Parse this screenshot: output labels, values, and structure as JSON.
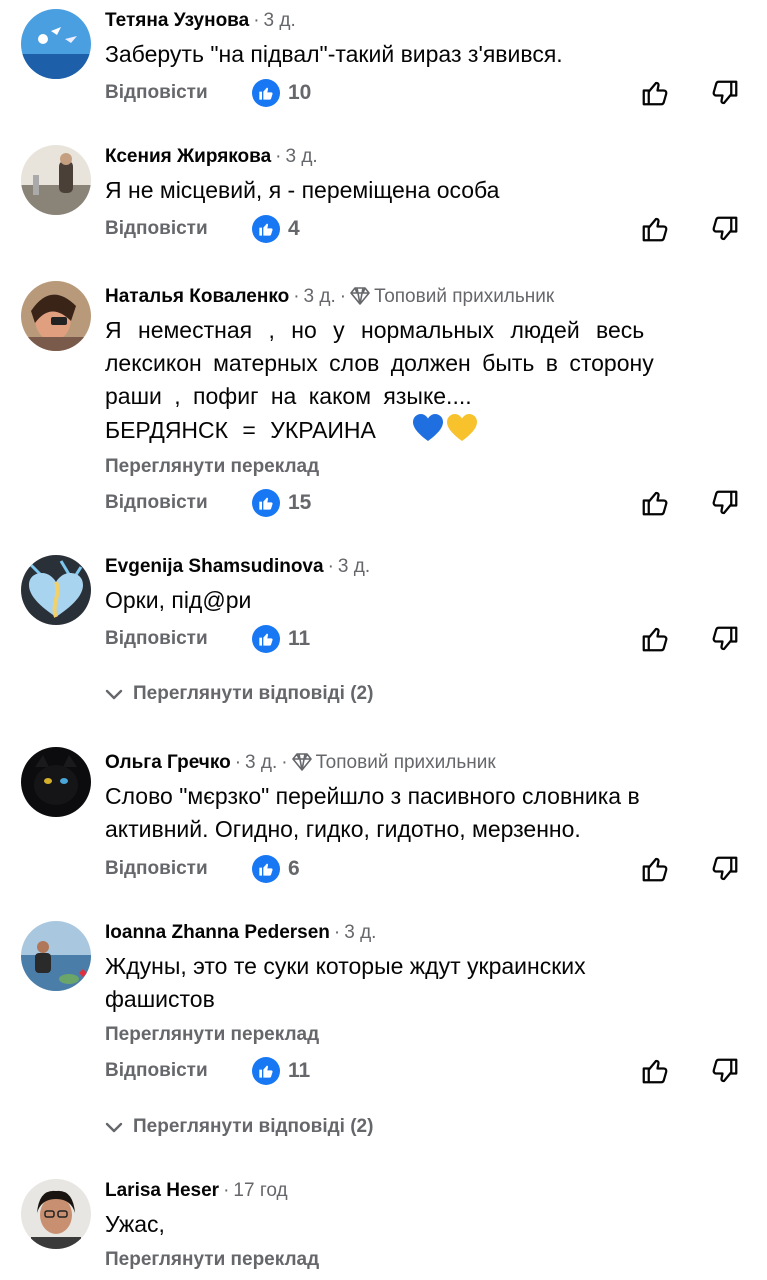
{
  "ui": {
    "reply_label": "Відповісти",
    "translate_label": "Переглянути переклад",
    "badge_label": "Топовий прихильник",
    "like_color": "#1877f2",
    "icons": [
      "like-badge-icon",
      "thumb-up-icon",
      "thumb-down-icon",
      "chevron-down-icon",
      "diamond-icon",
      "blue-heart-icon",
      "yellow-heart-icon"
    ]
  },
  "comments": [
    {
      "author": "Тетяна Узунова",
      "time": "3 д.",
      "lines": [
        "Заберуть \"на підвал\"-такий вираз з'явився."
      ],
      "likes": "10"
    },
    {
      "author": "Ксения Жирякова",
      "time": "3 д.",
      "lines": [
        "Я не місцевий, я - переміщена особа"
      ],
      "likes": "4"
    },
    {
      "author": "Наталья Коваленко",
      "time": "3 д.",
      "lines": [
        "Я неместная , но у нормальных людей весь",
        "лексикон матерных слов должен быть в сторону",
        "раши , пофиг на каком языке....",
        "БЕРДЯНСК = УКРАИНА"
      ],
      "likes": "15"
    },
    {
      "author": "Evgenija Shamsudinova",
      "time": "3 д.",
      "lines": [
        "Орки, під@ри"
      ],
      "likes": "11",
      "replies": "Переглянути відповіді (2)"
    },
    {
      "author": "Ольга Гречко",
      "time": "3 д.",
      "lines": [
        "Слово \"мєрзко\" перейшло з пасивного словника в",
        "активний. Огидно, гидко, гидотно, мерзенно."
      ],
      "likes": "6"
    },
    {
      "author": "Ioanna Zhanna Pedersen",
      "time": "3 д.",
      "lines": [
        "Ждуны, это те суки которые ждут украинских",
        "фашистов"
      ],
      "likes": "11",
      "replies": "Переглянути відповіді (2)"
    },
    {
      "author": "Larisa Heser",
      "time": "17 год",
      "lines": [
        "Ужас,"
      ]
    }
  ]
}
